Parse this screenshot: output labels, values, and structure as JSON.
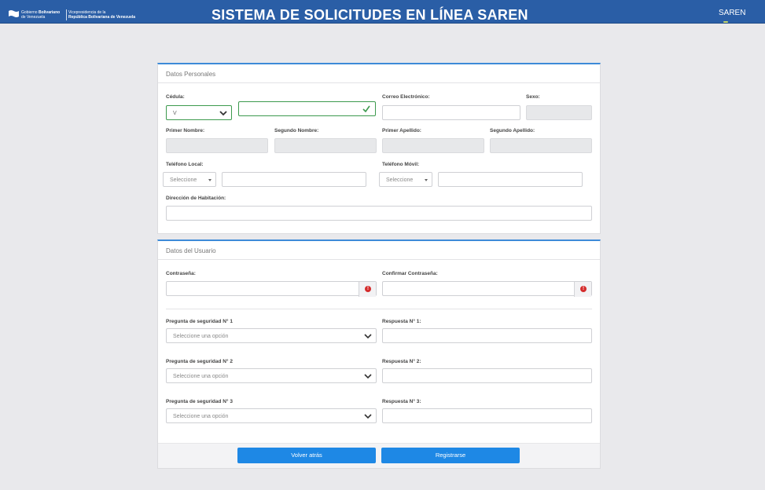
{
  "header": {
    "gov_line1": "Gobierno",
    "gov_line1_bold": "Bolivariano",
    "gov_line2": "de Venezuela",
    "vice_line1": "Vicepresidencia de la",
    "vice_line2": "República Bolivariana de Venezuela",
    "title": "SISTEMA DE SOLICITUDES EN LÍNEA SAREN",
    "user": "SAREN"
  },
  "personal": {
    "heading": "Datos Personales",
    "cedula_label": "Cédula:",
    "cedula_type_value": "V",
    "cedula_value": "",
    "email_label": "Correo Electrónico:",
    "sexo_label": "Sexo:",
    "primer_nombre_label": "Primer Nombre:",
    "segundo_nombre_label": "Segundo Nombre:",
    "primer_apellido_label": "Primer Apellido:",
    "segundo_apellido_label": "Segundo Apellido:",
    "telefono_local_label": "Teléfono Local:",
    "telefono_local_select": "Seleccione",
    "telefono_movil_label": "Teléfono Móvil:",
    "telefono_movil_select": "Seleccione",
    "direccion_label": "Dirección de Habitación:"
  },
  "usuario": {
    "heading": "Datos del Usuario",
    "password_label": "Contraseña:",
    "confirm_label": "Confirmar Contraseña:",
    "questions": [
      {
        "label": "Pregunta de seguridad N° 1",
        "placeholder": "Seleccione una opción",
        "answer_label": "Respuesta N° 1:"
      },
      {
        "label": "Pregunta de seguridad N° 2",
        "placeholder": "Seleccione una opción",
        "answer_label": "Respuesta N° 2:"
      },
      {
        "label": "Pregunta de seguridad N° 3",
        "placeholder": "Seleccione una opción",
        "answer_label": "Respuesta N° 3:"
      }
    ]
  },
  "actions": {
    "back_label": "Volver atrás",
    "register_label": "Registrarse"
  },
  "colors": {
    "header_bg": "#2a5ea6",
    "accent": "#1e88e5",
    "valid": "#3d9a4e",
    "error": "#d42c2c"
  },
  "icons": [
    "venezuela-flag-icon",
    "chevron-down-icon",
    "check-icon",
    "error-icon",
    "caret-down-icon"
  ]
}
